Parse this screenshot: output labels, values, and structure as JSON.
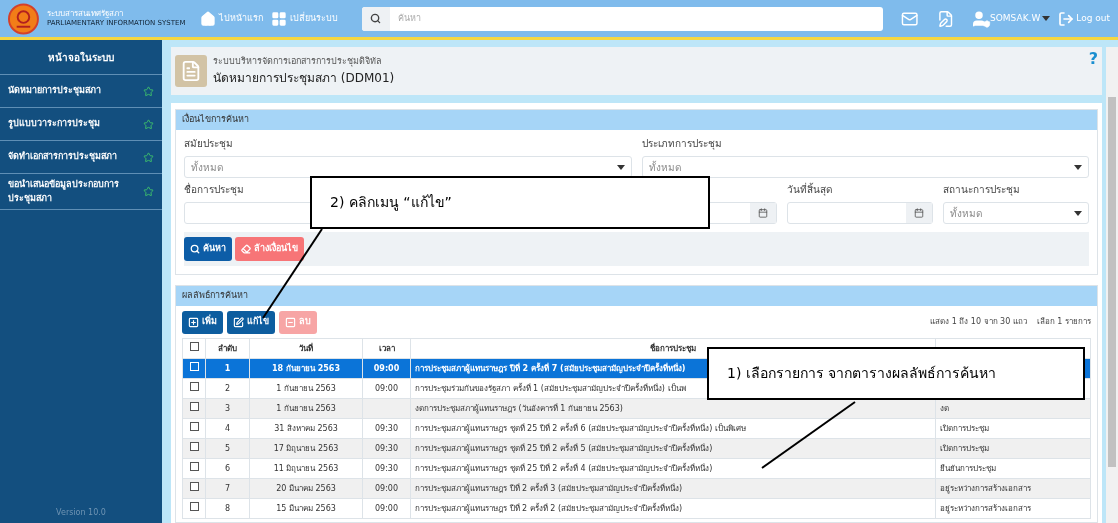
{
  "topbar": {
    "logo_lines": [
      "ระบบสารสนเทศรัฐสภา",
      "PARLIAMENTARY INFORMATION SYSTEM"
    ],
    "nav": [
      {
        "kind": "home",
        "label": "ไปหน้าแรก"
      },
      {
        "kind": "grid",
        "label": "เปลี่ยนระบบ"
      }
    ],
    "search": {
      "placeholder": "ค้นหา"
    },
    "user": "SOMSAK.W",
    "logout": "Log out"
  },
  "sidebar": {
    "title": "หน้าจอในระบบ",
    "items": [
      {
        "label": "นัดหมายการประชุมสภา"
      },
      {
        "label": "รูปแบบวาระการประชุม"
      },
      {
        "label": "จัดทำเอกสารการประชุมสภา"
      },
      {
        "label": "ขอนำเสนอข้อมูลประกอบการประชุมสภา"
      }
    ],
    "version": "Version 10.0"
  },
  "page_header": {
    "subtitle": "ระบบบริหารจัดการเอกสารการประชุมดิจิทัล",
    "title": "นัดหมายการประชุมสภา (DDM01)",
    "help": "?"
  },
  "search_panel": {
    "title": "เงื่อนไขการค้นหา",
    "rows": [
      [
        {
          "kind": "select",
          "label": "สมัยประชุม",
          "value": "ทั้งหมด"
        },
        {
          "kind": "select",
          "label": "ประเภทการประชุม",
          "value": "ทั้งหมด"
        }
      ],
      [
        {
          "kind": "text",
          "label": "ชื่อการประชุม"
        },
        {
          "kind": "date"
        },
        {
          "kind": "date",
          "label": "วันที่สิ้นสุด"
        },
        {
          "kind": "select",
          "label": "สถานะการประชุม",
          "value": "ทั้งหมด"
        }
      ]
    ],
    "buttons": [
      {
        "kind": "search",
        "label": "ค้นหา"
      },
      {
        "kind": "clear",
        "label": "ล้างเงื่อนไข"
      }
    ]
  },
  "results": {
    "title": "ผลลัพธ์การค้นหา",
    "buttons": [
      {
        "kind": "add",
        "label": "เพิ่ม",
        "disabled": false
      },
      {
        "kind": "edit",
        "label": "แก้ไข",
        "disabled": false
      },
      {
        "kind": "delete",
        "label": "ลบ",
        "disabled": true
      }
    ],
    "info": [
      "แสดง 1 ถึง 10 จาก 30 แถว",
      "เลือก 1 รายการ"
    ],
    "all_checked": false,
    "columns": [
      "ลำดับ",
      "วันที่",
      "เวลา",
      "ชื่อการประชุม"
    ],
    "rows": [
      {
        "selected": true,
        "checked": false,
        "cells": [
          "1",
          "18 กันยายน 2563",
          "09:00",
          "การประชุมสภาผู้แทนราษฎร ปีที่ 2 ครั้งที่ 7 (สมัยประชุมสามัญประจำปีครั้งที่หนึ่ง)",
          ""
        ]
      },
      {
        "selected": false,
        "checked": false,
        "cells": [
          "2",
          "1 กันยายน 2563",
          "09:00",
          "การประชุมร่วมกันของรัฐสภา ครั้งที่ 1 (สมัยประชุมสามัญประจำปีครั้งที่หนึ่ง) เป็นพ",
          ""
        ]
      },
      {
        "selected": false,
        "checked": false,
        "cells": [
          "3",
          "1 กันยายน 2563",
          "",
          "งดการประชุมสภาผู้แทนราษฎร (วันอังคารที่ 1 กันยายน 2563)",
          "งด"
        ]
      },
      {
        "selected": false,
        "checked": false,
        "cells": [
          "4",
          "31 สิงหาคม 2563",
          "09:30",
          "การประชุมสภาผู้แทนราษฎร ชุดที่ 25 ปีที่ 2 ครั้งที่ 6 (สมัยประชุมสามัญประจำปีครั้งที่หนึ่ง) เป็นพิเศษ",
          "เปิดการประชุม"
        ]
      },
      {
        "selected": false,
        "checked": false,
        "cells": [
          "5",
          "17 มิถุนายน 2563",
          "09:30",
          "การประชุมสภาผู้แทนราษฎร ชุดที่ 25 ปีที่ 2 ครั้งที่ 5 (สมัยประชุมสามัญประจำปีครั้งที่หนึ่ง)",
          "เปิดการประชุม"
        ]
      },
      {
        "selected": false,
        "checked": false,
        "cells": [
          "6",
          "11 มิถุนายน 2563",
          "09:30",
          "การประชุมสภาผู้แทนราษฎร ชุดที่ 25 ปีที่ 2 ครั้งที่ 4 (สมัยประชุมสามัญประจำปีครั้งที่หนึ่ง)",
          "ยืนยันการประชุม"
        ]
      },
      {
        "selected": false,
        "checked": false,
        "cells": [
          "7",
          "20 มีนาคม 2563",
          "09:00",
          "การประชุมสภาผู้แทนราษฎร ปีที่ 2 ครั้งที่ 3 (สมัยประชุมสามัญประจำปีครั้งที่หนึ่ง)",
          "อยู่ระหว่างการสร้างเอกสาร"
        ]
      },
      {
        "selected": false,
        "checked": false,
        "cells": [
          "8",
          "15 มีนาคม 2563",
          "09:00",
          "การประชุมสภาผู้แทนราษฎร ปีที่ 2 ครั้งที่ 2 (สมัยประชุมสามัญประจำปีครั้งที่หนึ่ง)",
          "อยู่ระหว่างการสร้างเอกสาร"
        ]
      }
    ]
  },
  "callouts": [
    {
      "kind": "edit",
      "text": "2) คลิกเมนู “แก้ไข”"
    },
    {
      "kind": "select",
      "text": "1) เลือกรายการ จากตารางผลลัพธ์การค้นหา"
    }
  ]
}
